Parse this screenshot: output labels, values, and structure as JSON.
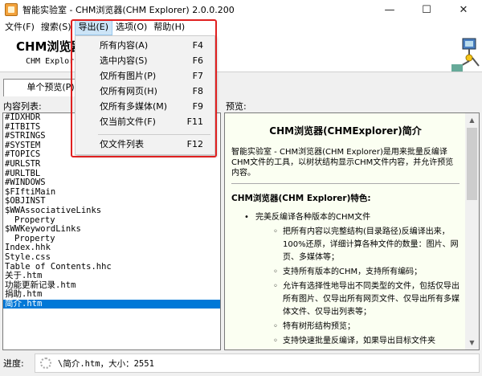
{
  "window": {
    "title": "智能实验室 - CHM浏览器(CHM Explorer) 2.0.0.200"
  },
  "controls": {
    "minimize": "—",
    "maximize": "☐",
    "close": "✕"
  },
  "menu": {
    "items": [
      "文件(F)",
      "搜索(S)",
      "导出(E)",
      "选项(O)",
      "帮助(H)"
    ],
    "active_index": 2
  },
  "banner": {
    "title": "CHM浏览器",
    "subtitle": "CHM Explor"
  },
  "tabs": {
    "single_preview": "单个预览(P)"
  },
  "left_panel": {
    "label": "内容列表:",
    "items": [
      "#IDXHDR",
      "#ITBITS",
      "#STRINGS",
      "#SYSTEM",
      "#TOPICS",
      "#URLSTR",
      "#URLTBL",
      "#WINDOWS",
      "$FIftiMain",
      "$OBJINST",
      "$WWAssociativeLinks",
      "Property",
      "$WWKeywordLinks",
      "Property",
      "Index.hhk",
      "Style.css",
      "Table of Contents.hhc",
      "关于.htm",
      "功能更新记录.htm",
      "捐助.htm",
      "简介.htm"
    ],
    "selected_index": 20
  },
  "right_panel": {
    "label": "预览:",
    "title": "CHM浏览器(CHMExplorer)简介",
    "intro": "智能实验室 - CHM浏览器(CHM Explorer)是用来批量反编译CHM文件的工具，以树状结构显示CHM文件内容，并允许预览内容。",
    "features_heading": "CHM浏览器(CHM Explorer)特色:",
    "feature": "完美反编译各种版本的CHM文件",
    "sub_features": [
      "把所有内容以完整结构(目录路径)反编译出来，100%还原，详细计算各种文件的数量：图片、网页、多媒体等；",
      "支持所有版本的CHM，支持所有编码；",
      "允许有选择性地导出不同类型的文件，包括仅导出所有图片、仅导出所有网页文件、仅导出所有多媒体文件、仅导出列表等；",
      "特有树形结构预览；",
      "支持快速批量反编译，如果导出目标文件夹"
    ]
  },
  "status": {
    "label": "进度:",
    "text": "\\简介.htm，大小：2551"
  },
  "export_menu": {
    "items": [
      {
        "label": "所有内容(A)",
        "shortcut": "F4"
      },
      {
        "label": "选中内容(S)",
        "shortcut": "F6"
      },
      {
        "label": "仅所有图片(P)",
        "shortcut": "F7"
      },
      {
        "label": "仅所有网页(H)",
        "shortcut": "F8"
      },
      {
        "label": "仅所有多媒体(M)",
        "shortcut": "F9"
      },
      {
        "label": "仅当前文件(F)",
        "shortcut": "F11"
      },
      {
        "label": "仅文件列表",
        "shortcut": "F12"
      }
    ]
  },
  "colors": {
    "highlight": "#e02020",
    "selection": "#0078d7",
    "preview_bg": "#fbfff2"
  }
}
